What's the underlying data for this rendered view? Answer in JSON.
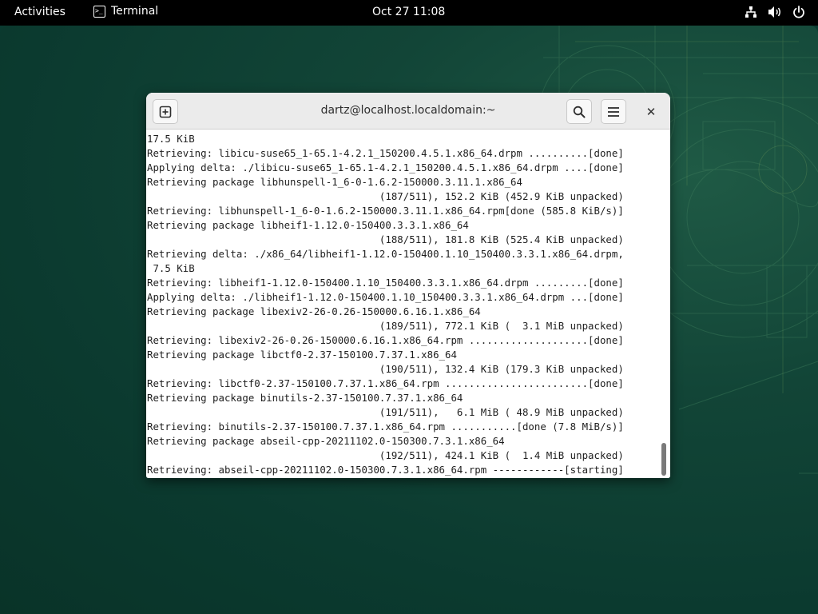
{
  "topbar": {
    "activities": "Activities",
    "app_name": "Terminal",
    "app_icon": "terminal-icon",
    "clock": "Oct 27  11:08",
    "status_icons": [
      "network-icon",
      "volume-icon",
      "power-icon"
    ]
  },
  "window": {
    "title": "dartz@localhost.localdomain:~",
    "buttons": [
      "new-tab-icon",
      "search-icon",
      "hamburger-menu-icon",
      "close-icon"
    ],
    "close_glyph": "✕"
  },
  "terminal": {
    "lines": [
      "17.5 KiB",
      "Retrieving: libicu-suse65_1-65.1-4.2.1_150200.4.5.1.x86_64.drpm ..........[done]",
      "Applying delta: ./libicu-suse65_1-65.1-4.2.1_150200.4.5.1.x86_64.drpm ....[done]",
      "Retrieving package libhunspell-1_6-0-1.6.2-150000.3.11.1.x86_64",
      "                                       (187/511), 152.2 KiB (452.9 KiB unpacked)",
      "Retrieving: libhunspell-1_6-0-1.6.2-150000.3.11.1.x86_64.rpm[done (585.8 KiB/s)]",
      "Retrieving package libheif1-1.12.0-150400.3.3.1.x86_64",
      "                                       (188/511), 181.8 KiB (525.4 KiB unpacked)",
      "Retrieving delta: ./x86_64/libheif1-1.12.0-150400.1.10_150400.3.3.1.x86_64.drpm,",
      " 7.5 KiB",
      "Retrieving: libheif1-1.12.0-150400.1.10_150400.3.3.1.x86_64.drpm .........[done]",
      "Applying delta: ./libheif1-1.12.0-150400.1.10_150400.3.3.1.x86_64.drpm ...[done]",
      "Retrieving package libexiv2-26-0.26-150000.6.16.1.x86_64",
      "                                       (189/511), 772.1 KiB (  3.1 MiB unpacked)",
      "Retrieving: libexiv2-26-0.26-150000.6.16.1.x86_64.rpm ....................[done]",
      "Retrieving package libctf0-2.37-150100.7.37.1.x86_64",
      "                                       (190/511), 132.4 KiB (179.3 KiB unpacked)",
      "Retrieving: libctf0-2.37-150100.7.37.1.x86_64.rpm ........................[done]",
      "Retrieving package binutils-2.37-150100.7.37.1.x86_64",
      "                                       (191/511),   6.1 MiB ( 48.9 MiB unpacked)",
      "Retrieving: binutils-2.37-150100.7.37.1.x86_64.rpm ...........[done (7.8 MiB/s)]",
      "Retrieving package abseil-cpp-20211102.0-150300.7.3.1.x86_64",
      "                                       (192/511), 424.1 KiB (  1.4 MiB unpacked)",
      "Retrieving: abseil-cpp-20211102.0-150300.7.3.1.x86_64.rpm ------------[starting]"
    ]
  },
  "colors": {
    "desktop": "#0b3a2f",
    "topbar": "#000000",
    "headerbar": "#ebebeb",
    "terminal_bg": "#ffffff",
    "terminal_fg": "#1e1e1e"
  }
}
